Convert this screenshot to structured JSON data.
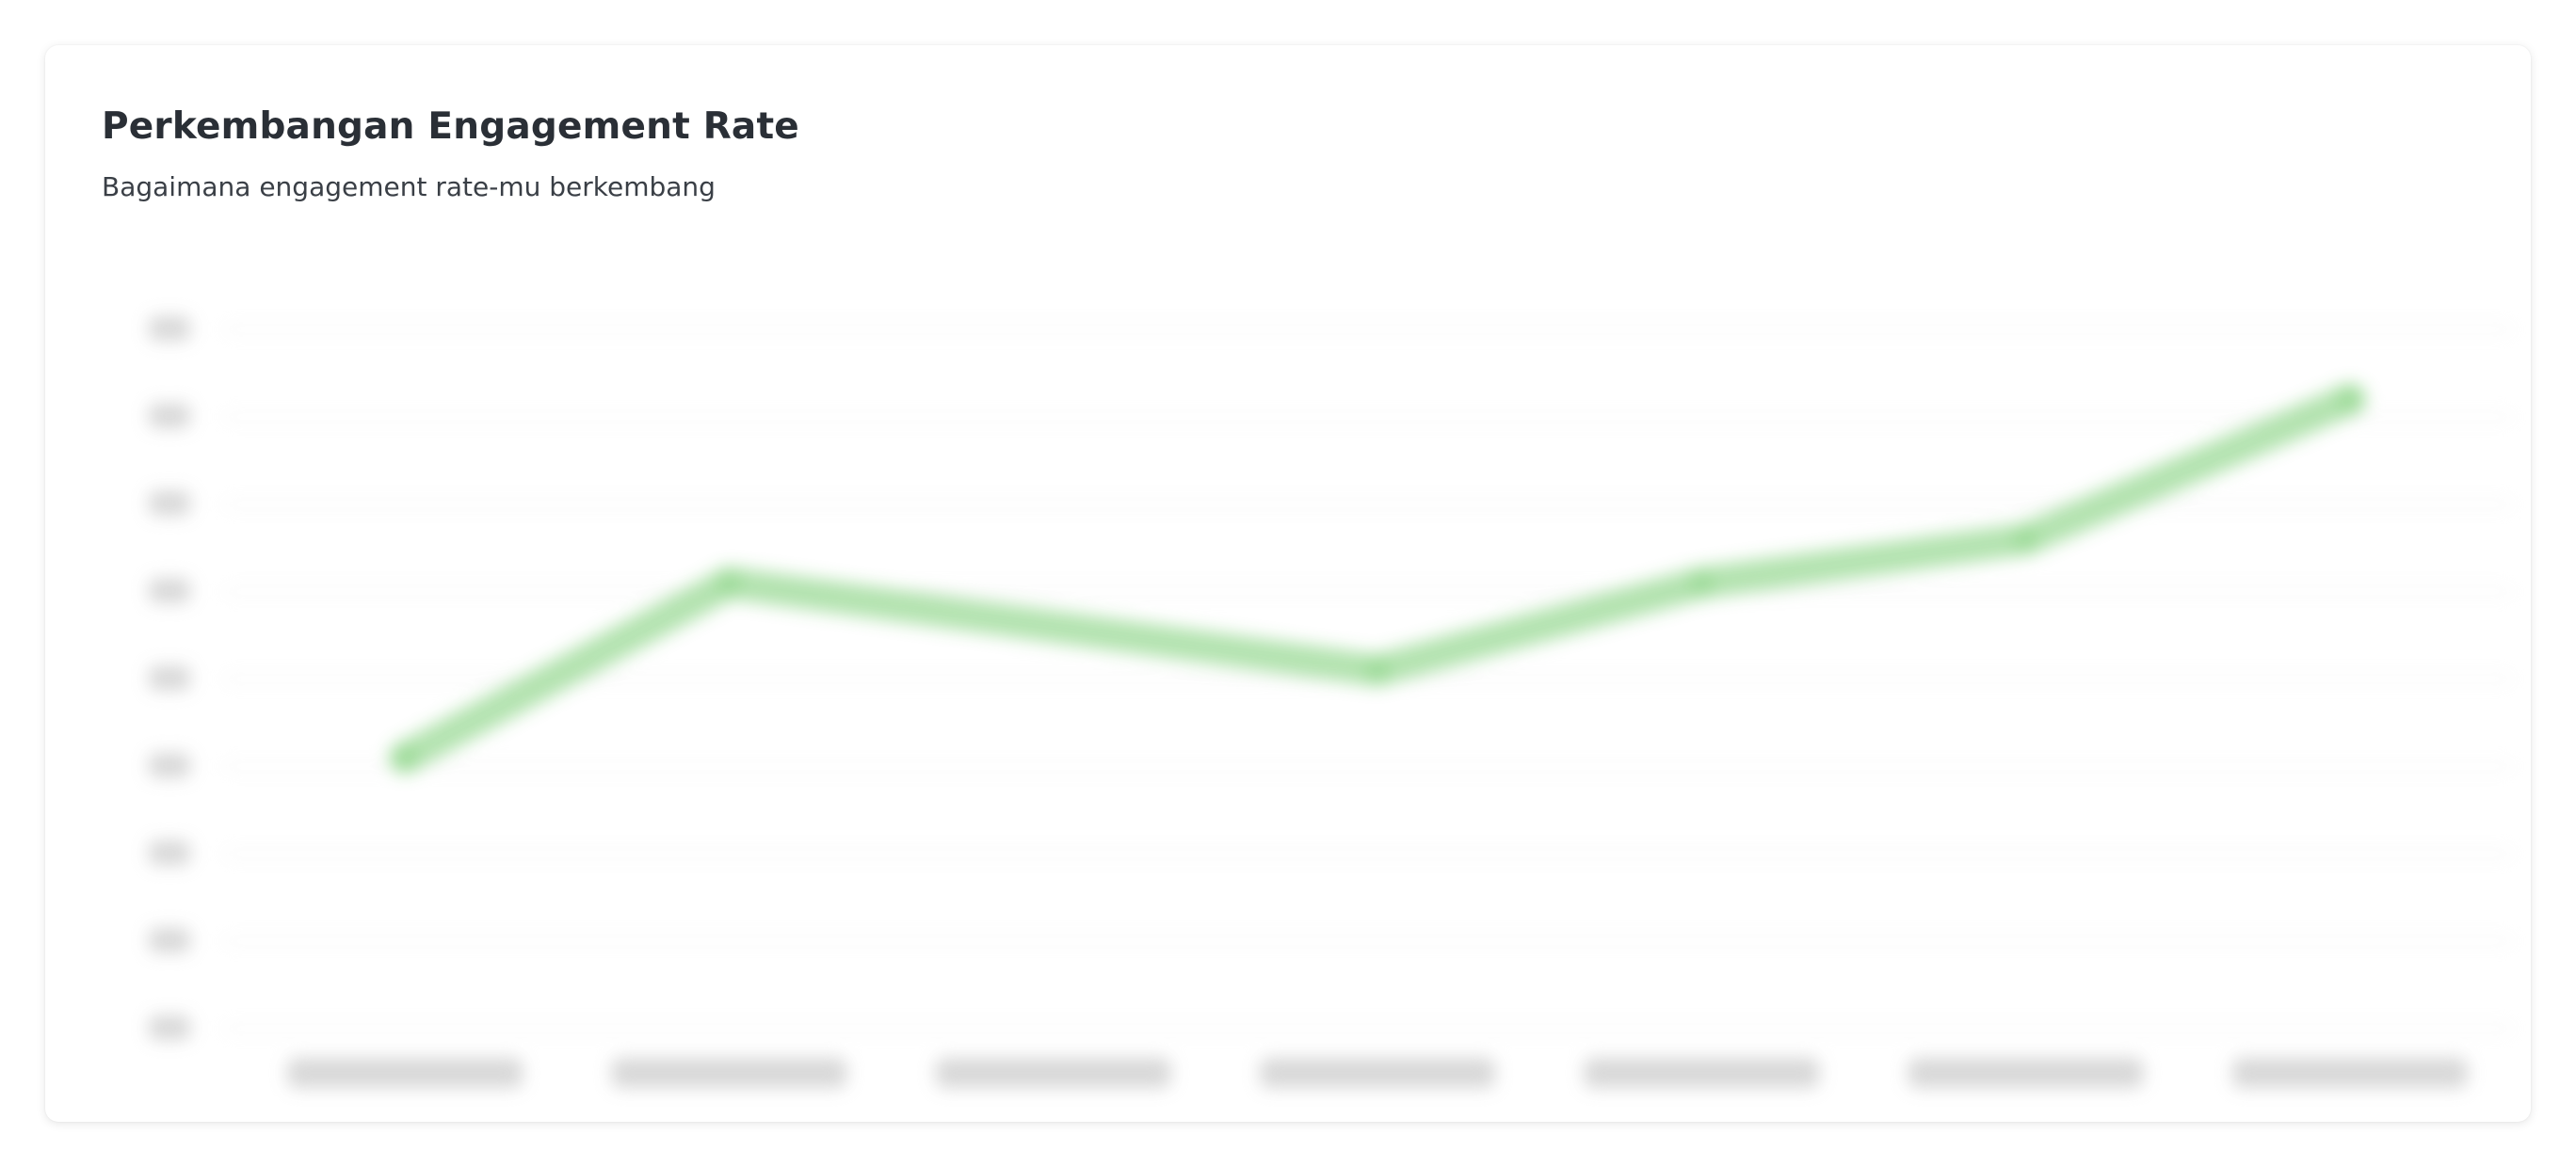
{
  "card": {
    "title": "Perkembangan Engagement Rate",
    "subtitle": "Bagaimana engagement rate-mu berkembang"
  },
  "colors": {
    "line": "#8fd68a",
    "grid": "#eeeeee",
    "axis_label_blob": "#d4d4d4",
    "title": "#2a2f36"
  },
  "chart_data": {
    "type": "line",
    "note_visibility": "blurred",
    "categories": [
      "",
      "",
      "",
      "",
      "",
      "",
      ""
    ],
    "series": [
      {
        "values": [
          3.1,
          5.1,
          null,
          4.1,
          null,
          5.6,
          7.2
        ]
      }
    ],
    "points": [
      {
        "x": 0.5,
        "y": 3.1
      },
      {
        "x": 1.5,
        "y": 5.1
      },
      {
        "x": 3.5,
        "y": 4.1
      },
      {
        "x": 4.5,
        "y": 5.1
      },
      {
        "x": 5.5,
        "y": 5.6
      },
      {
        "x": 6.5,
        "y": 7.2
      }
    ],
    "ylim": [
      0,
      8
    ],
    "yticks": [
      0,
      1,
      2,
      3,
      4,
      5,
      6,
      7,
      8
    ],
    "xlim": [
      0,
      7
    ],
    "grid": true,
    "legend": "none"
  }
}
